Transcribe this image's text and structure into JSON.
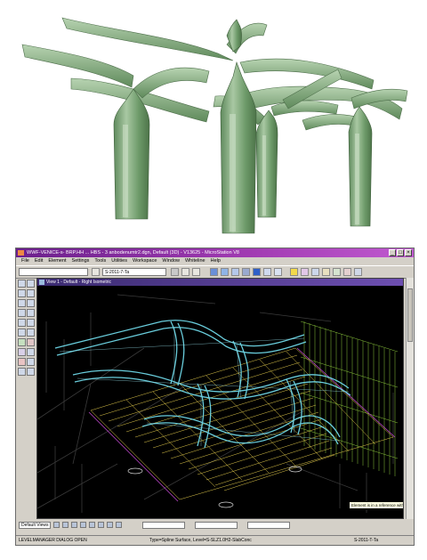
{
  "window": {
    "title": "WWF-VENICE-s- BRP.HH ... HBS - 3 anbodenumtr2.dgn, Default (3D) - V13625 - MicroStation V8",
    "buttons": [
      "_",
      "□",
      "×"
    ]
  },
  "menubar": [
    "File",
    "Edit",
    "Element",
    "Settings",
    "Tools",
    "Utilities",
    "Workspace",
    "Window",
    "Whiteline",
    "Help"
  ],
  "toolbar": {
    "level_value": "S-2011-7-Ta",
    "level_selector_label": ""
  },
  "view": {
    "title": "View 1 - Default - Right Isometric"
  },
  "tooltip": "Element is in a reference with locate turned off",
  "viewbar": {
    "view_select": "Default Views",
    "fields": [
      "",
      "",
      ""
    ]
  },
  "statusbar": {
    "left": "LEVELMANAGER DIALOG OPEN",
    "center": "Type=Spline Surface, Level=S-SLZ1.0H2-SlabConc",
    "right": "S-2011-T-Ta"
  },
  "colors": {
    "structure_green": "#6f9a6c",
    "wire_cyan": "#6fd8e8",
    "wire_yellow": "#e0c84a",
    "wire_green": "#8cc83c",
    "title_purple": "#8a2ea3"
  }
}
